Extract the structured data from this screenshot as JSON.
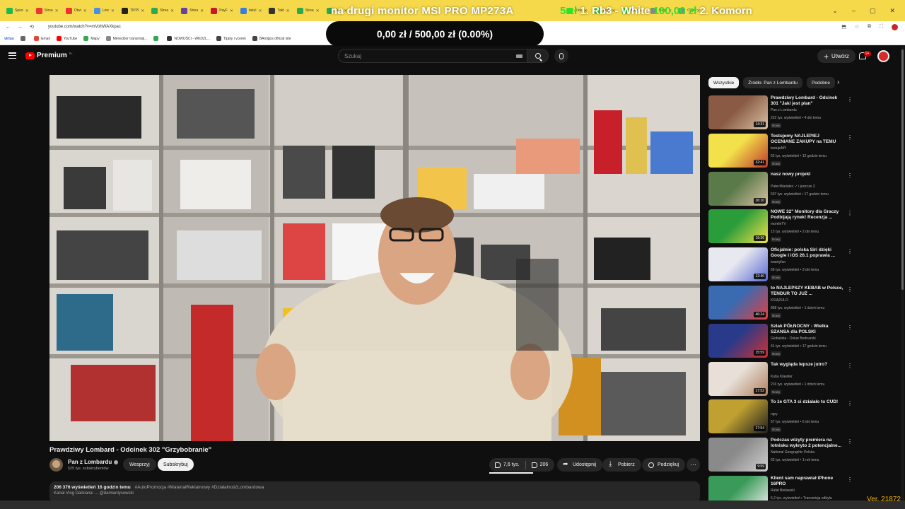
{
  "browser": {
    "tabs": [
      {
        "label": "Spoo",
        "color": "#1db954"
      },
      {
        "label": "Strea",
        "color": "#e33"
      },
      {
        "label": "Otwi",
        "color": "#e33"
      },
      {
        "label": "Low",
        "color": "#4a90e2"
      },
      {
        "label": "TIPPl",
        "color": "#222"
      },
      {
        "label": "Strea",
        "color": "#2fa84f"
      },
      {
        "label": "Strea",
        "color": "#6441a5"
      },
      {
        "label": "PayF",
        "color": "#c9162b"
      },
      {
        "label": "takul",
        "color": "#3b7ddd"
      },
      {
        "label": "Takt",
        "color": "#333"
      },
      {
        "label": "Strea",
        "color": "#2fa84f"
      },
      {
        "label": "Achi",
        "color": "#2fa84f"
      }
    ],
    "tabs_right": [
      {
        "label": "Kick",
        "color": "#2fe12b"
      },
      {
        "label": "Kick",
        "color": "#2fe12b"
      },
      {
        "label": "Kick",
        "color": "#2fe12b"
      },
      {
        "label": "Nagl",
        "color": "#888"
      },
      {
        "label": "Capi",
        "color": "#888"
      }
    ],
    "new_tab": "+",
    "window_controls": [
      "⌄",
      "–",
      "▢",
      "✕"
    ],
    "url": "youtube.com/watch?v=mVohWAXkpac",
    "nav": [
      "←",
      "→",
      "C",
      "⟲"
    ],
    "addr_icons": [
      "⬒",
      "☆",
      "⧉",
      "⛶"
    ],
    "bookmarks": [
      {
        "label": "virtus",
        "color": "#2a5dcc"
      },
      {
        "label": "",
        "color": "#666"
      },
      {
        "label": "Gmail",
        "color": "#ea4335"
      },
      {
        "label": "YouTube",
        "color": "#ff0000"
      },
      {
        "label": "Mapy",
        "color": "#34a853"
      },
      {
        "label": "Menedżer transmisji...",
        "color": "#888"
      },
      {
        "label": "",
        "color": "#2fa84f"
      },
      {
        "label": "NOWOŚCI - WKDZL...",
        "color": "#333"
      },
      {
        "label": "Tipply i vcerek",
        "color": "#444"
      },
      {
        "label": "BAmigos official site",
        "color": "#444"
      }
    ]
  },
  "stream_overlay": {
    "monitor_text": "na drugi monitor MSI PRO MP273A",
    "bid_amount": "5 zł",
    "bid_info": "1. Rb3 - White",
    "bid_amount2": "100,00 zł",
    "bid_info2": "2. Komorn",
    "donation_goal": "0,00 zł / 500,00 zł (0.00%)",
    "version": "Ver. 21872"
  },
  "yt": {
    "logo": "Premium",
    "logo_region": "PL",
    "search_placeholder": "Szukaj",
    "create_label": "Utwórz",
    "notif_count": "9+"
  },
  "video": {
    "title": "Prawdziwy Lombard - Odcinek 302 \"Grzybobranie\"",
    "channel": "Pan z Lombardu",
    "subscribers": "525 tys. subskrybentów",
    "support_label": "Wesprzyj",
    "subscribe_label": "Subskrybuj",
    "likes": "7,6 tys.",
    "dislikes": "206",
    "share_label": "Udostępnij",
    "download_label": "Pobierz",
    "thanks_label": "Podziękuj",
    "more_label": "⋯",
    "views": "206 376 wyświetleń",
    "age": "16 godzin temu",
    "hashtags": "#AutoPromocja #MateriałReklamowy #DziałalnośćLombardowa",
    "desc_second_line": "Kanał Vlog Damiana: ... @damianlysowski"
  },
  "sidebar": {
    "chips": [
      {
        "label": "Wszystkie",
        "active": true
      },
      {
        "label": "Źródło: Pan z Lombardu",
        "active": false
      },
      {
        "label": "Podobne",
        "active": false
      }
    ],
    "chip_next": "›",
    "items": [
      {
        "title": "Prawdziwy Lombard - Odcinek 301 \"Jaki jest plan\"",
        "channel": "Pan z Lombardu",
        "meta": "222 tys. wyświetleń • 4 dni temu",
        "badge": "Nowy",
        "duration": "14:31",
        "c1": "#8a5a44",
        "c2": "#d9c2a6"
      },
      {
        "title": "Testujemy NAJLEPIEJ OCENIANE ZAKUPY na TEMU",
        "channel": "testujeMY",
        "meta": "52 tys. wyświetleń • 12 godzin temu",
        "badge": "Nowy",
        "duration": "32:41",
        "c1": "#f2e14a",
        "c2": "#c0392b"
      },
      {
        "title": "nasz nowy projekt",
        "channel": "PatecWariatec ✓ i jeszcze 2",
        "meta": "507 tys. wyświetleń • 17 godzin temu",
        "badge": "Nowy",
        "duration": "36:10",
        "c1": "#5a7a4a",
        "c2": "#d8c0a0"
      },
      {
        "title": "NOWE 32\" Monitory dla Graczy Podbijają rynek!  Recenzja ...",
        "channel": "moreleTV",
        "meta": "15 tys. wyświetleń • 2 dni temu",
        "badge": "Nowy",
        "duration": "19:36",
        "c1": "#2a9d3a",
        "c2": "#f2e14a"
      },
      {
        "title": "Oficjalnie: polska Siri dzięki Google i iOS 26.1 poprawia ...",
        "channel": "iwantyfan",
        "meta": "66 tys. wyświetleń • 3 dni temu",
        "badge": "Nowy",
        "duration": "12:40",
        "c1": "#e8e8f0",
        "c2": "#5a6ad0"
      },
      {
        "title": "to NAJLEPSZY KEBAB w Polsce, TENDUR TO JUŻ ...",
        "channel": "KSIĄŻULO",
        "meta": "868 tys. wyświetleń • 1 dzień temu",
        "badge": "Nowy",
        "duration": "46:24",
        "c1": "#3a6ab0",
        "c2": "#e04040"
      },
      {
        "title": "Szlak PÓŁNOCNY - Wielka SZANSA dla POLSKI",
        "channel": "Globalista - Oskar Bednarski",
        "meta": "41 tys. wyświetleń • 17 godzin temu",
        "badge": "Nowy",
        "duration": "15:59",
        "c1": "#2a3a8a",
        "c2": "#d03030"
      },
      {
        "title": "Tak wygląda lepsze jutro?",
        "channel": "Kuba Klawiter",
        "meta": "216 tys. wyświetleń • 1 dzień temu",
        "badge": "Nowy",
        "duration": "17:52",
        "c1": "#e8e0d8",
        "c2": "#b08060"
      },
      {
        "title": "To że GTA 3 ci działało to CUD!",
        "channel": "ngry",
        "meta": "57 tys. wyświetleń • 6 dni temu",
        "badge": "Nowy",
        "duration": "27:54",
        "c1": "#c0a030",
        "c2": "#202020"
      },
      {
        "title": "Podczas wizyty premiera na lotnisku wykryto 2 potencjalne...",
        "channel": "National Geographic Polska",
        "meta": "62 tys. wyświetleń • 1 rok temu",
        "badge": "",
        "duration": "9:59",
        "c1": "#8a8a8a",
        "c2": "#d0d0d0"
      },
      {
        "title": "Klient sam naprawiał iPhone 16PRO",
        "channel": "Rafał Bielawski",
        "meta": "5,2 tys. wyświetleń • Transmisja odbyła",
        "badge": "",
        "duration": "",
        "c1": "#3a9a5a",
        "c2": "#f0f0f0"
      }
    ]
  }
}
